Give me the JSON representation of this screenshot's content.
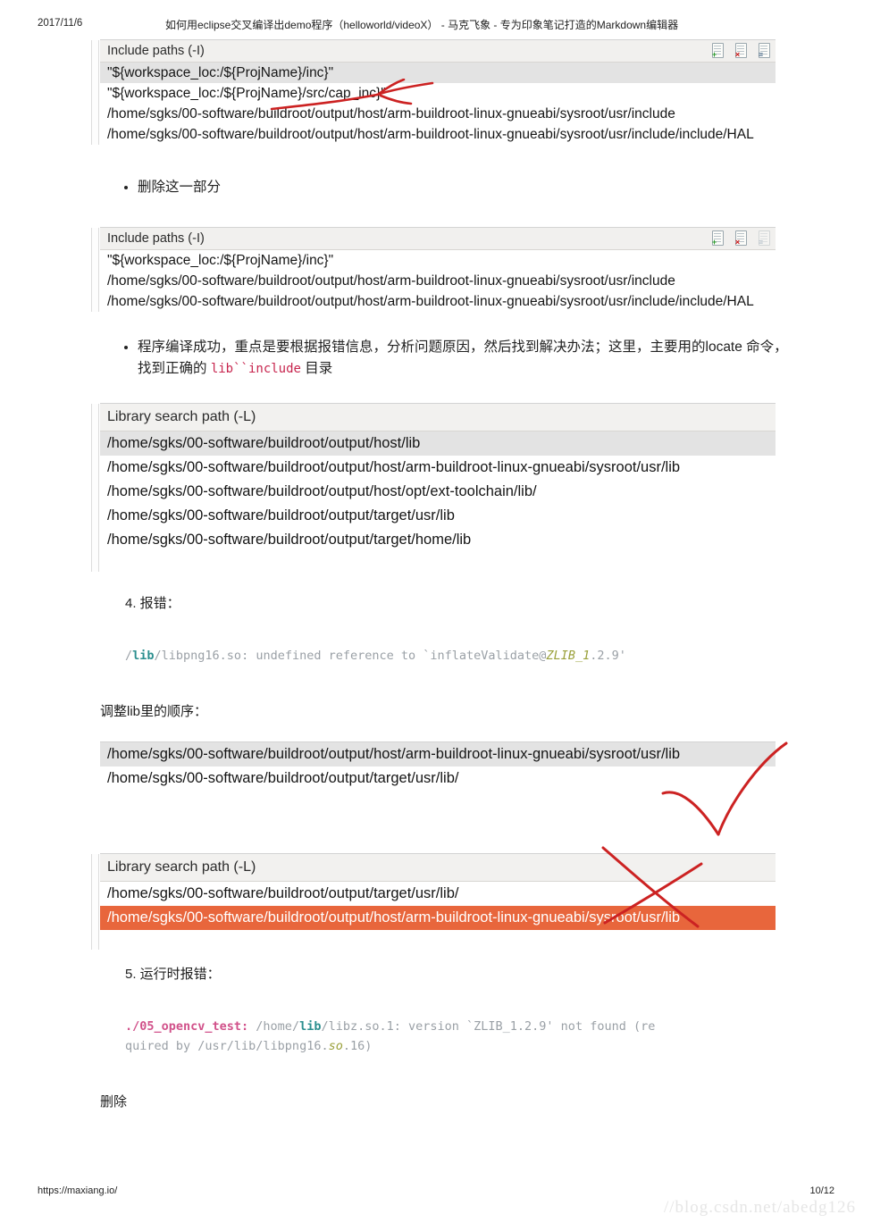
{
  "print_header": {
    "date": "2017/11/6",
    "title": "如何用eclipse交叉编译出demo程序（helloworld/videoX） - 马克飞象 - 专为印象笔记打造的Markdown编辑器"
  },
  "panels": [
    {
      "id": "include-paths-before",
      "header": "Include paths (-I)",
      "icons": [
        {
          "name": "add-page-icon",
          "glyph": "+"
        },
        {
          "name": "delete-page-icon",
          "glyph": "×"
        },
        {
          "name": "edit-page-icon",
          "glyph": "≡"
        }
      ],
      "rows": [
        {
          "text": "\"${workspace_loc:/${ProjName}/inc}\"",
          "state": "selected"
        },
        {
          "text": "\"${workspace_loc:/${ProjName}/src/cap_inc}\"",
          "state": "normal"
        },
        {
          "text": "/home/sgks/00-software/buildroot/output/host/arm-buildroot-linux-gnueabi/sysroot/usr/include",
          "state": "normal"
        },
        {
          "text": "/home/sgks/00-software/buildroot/output/host/arm-buildroot-linux-gnueabi/sysroot/usr/include/include/HAL",
          "state": "normal"
        }
      ]
    },
    {
      "id": "include-paths-after",
      "header": "Include paths (-I)",
      "icons": [
        {
          "name": "add-page-icon",
          "glyph": "+"
        },
        {
          "name": "delete-page-icon",
          "glyph": "×"
        },
        {
          "name": "edit-page-icon",
          "glyph": "≡"
        }
      ],
      "rows": [
        {
          "text": "\"${workspace_loc:/${ProjName}/inc}\"",
          "state": "normal"
        },
        {
          "text": "/home/sgks/00-software/buildroot/output/host/arm-buildroot-linux-gnueabi/sysroot/usr/include",
          "state": "normal"
        },
        {
          "text": "/home/sgks/00-software/buildroot/output/host/arm-buildroot-linux-gnueabi/sysroot/usr/include/include/HAL",
          "state": "normal"
        }
      ]
    },
    {
      "id": "library-search-path-full",
      "header": "Library search path (-L)",
      "icons": [],
      "rows": [
        {
          "text": "/home/sgks/00-software/buildroot/output/host/lib",
          "state": "selected"
        },
        {
          "text": "/home/sgks/00-software/buildroot/output/host/arm-buildroot-linux-gnueabi/sysroot/usr/lib",
          "state": "normal"
        },
        {
          "text": "/home/sgks/00-software/buildroot/output/host/opt/ext-toolchain/lib/",
          "state": "normal"
        },
        {
          "text": "/home/sgks/00-software/buildroot/output/target/usr/lib",
          "state": "normal"
        },
        {
          "text": "/home/sgks/00-software/buildroot/output/target/home/lib",
          "state": "normal"
        }
      ]
    },
    {
      "id": "library-search-path-good",
      "header": "",
      "icons": [],
      "rows": [
        {
          "text": "/home/sgks/00-software/buildroot/output/host/arm-buildroot-linux-gnueabi/sysroot/usr/lib",
          "state": "selected"
        },
        {
          "text": "/home/sgks/00-software/buildroot/output/target/usr/lib/",
          "state": "normal"
        }
      ]
    },
    {
      "id": "library-search-path-bad",
      "header": "Library search path (-L)",
      "icons": [],
      "rows": [
        {
          "text": "/home/sgks/00-software/buildroot/output/target/usr/lib/",
          "state": "normal"
        },
        {
          "text": "/home/sgks/00-software/buildroot/output/host/arm-buildroot-linux-gnueabi/sysroot/usr/lib",
          "state": "highlighted"
        }
      ]
    }
  ],
  "notes": {
    "bullet_delete": "删除这一部分",
    "bullet_compile_part1": "程序编译成功，重点是要根据报错信息，分析问题原因，然后找到解决办法；这里，主要用的locate 命令，找到正确的 ",
    "bullet_compile_code": "lib``include",
    "bullet_compile_part2": " 目录",
    "step4": "4. 报错：",
    "adjust_order": "调整lib里的顺序：",
    "step5": "5. 运行时报错：",
    "trailing": "删除"
  },
  "code_blocks": {
    "link_error": {
      "segments": [
        {
          "text": "/",
          "token": "plain"
        },
        {
          "text": "lib",
          "token": "path"
        },
        {
          "text": "/libpng16.so: undefined reference to `inflateValidate@",
          "token": "plain"
        },
        {
          "text": "ZLIB_1",
          "token": "var"
        },
        {
          "text": ".2.9'",
          "token": "plain"
        }
      ]
    },
    "runtime_error": {
      "segments": [
        {
          "text": "./05_opencv_test:",
          "token": "cmd"
        },
        {
          "text": " /home/",
          "token": "plain"
        },
        {
          "text": "lib",
          "token": "path"
        },
        {
          "text": "/libz.so.1: version `ZLIB_1.2.9' not found (re",
          "token": "plain"
        },
        {
          "text": "\nquired by /usr/lib/libpng16.",
          "token": "plain"
        },
        {
          "text": "so",
          "token": "var"
        },
        {
          "text": ".16)",
          "token": "plain"
        }
      ]
    }
  },
  "annotations": [
    {
      "name": "red-arrow-annotation",
      "shape": "arrow",
      "target": "cap_inc path"
    },
    {
      "name": "red-check-annotation",
      "shape": "check",
      "target": "correct library order"
    },
    {
      "name": "red-cross-annotation",
      "shape": "cross",
      "target": "wrong library order"
    }
  ],
  "print_footer": {
    "url": "https://maxiang.io/",
    "page": "10/12",
    "watermark": "//blog.csdn.net/abedg126"
  },
  "colors": {
    "panel_header_bg": "#f1f0ee",
    "row_selected_bg": "#e3e3e3",
    "row_highlight_bg": "#e8663c",
    "annotation_red": "#cc2222",
    "code_text": "#9aa0a6",
    "inline_code": "#c7254e"
  }
}
